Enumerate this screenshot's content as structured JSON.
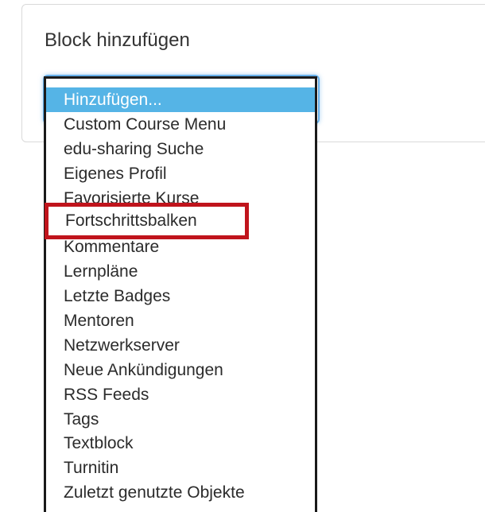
{
  "block": {
    "title": "Block hinzufügen"
  },
  "dropdown": {
    "options": [
      "Hinzufügen...",
      "Custom Course Menu",
      "edu-sharing Suche",
      "Eigenes Profil",
      "Favorisierte Kurse",
      "Fortschrittsbalken",
      "Kommentare",
      "Lernpläne",
      "Letzte Badges",
      "Mentoren",
      "Netzwerkserver",
      "Neue Ankündigungen",
      "RSS Feeds",
      "Tags",
      "Textblock",
      "Turnitin",
      "Zuletzt genutzte Objekte"
    ],
    "selected_index": 0,
    "highlighted_option": "Fortschrittsbalken"
  },
  "colors": {
    "selected_bg": "#55b4e6",
    "highlight_border": "#c0141c",
    "focus_glow": "#66afe9"
  }
}
